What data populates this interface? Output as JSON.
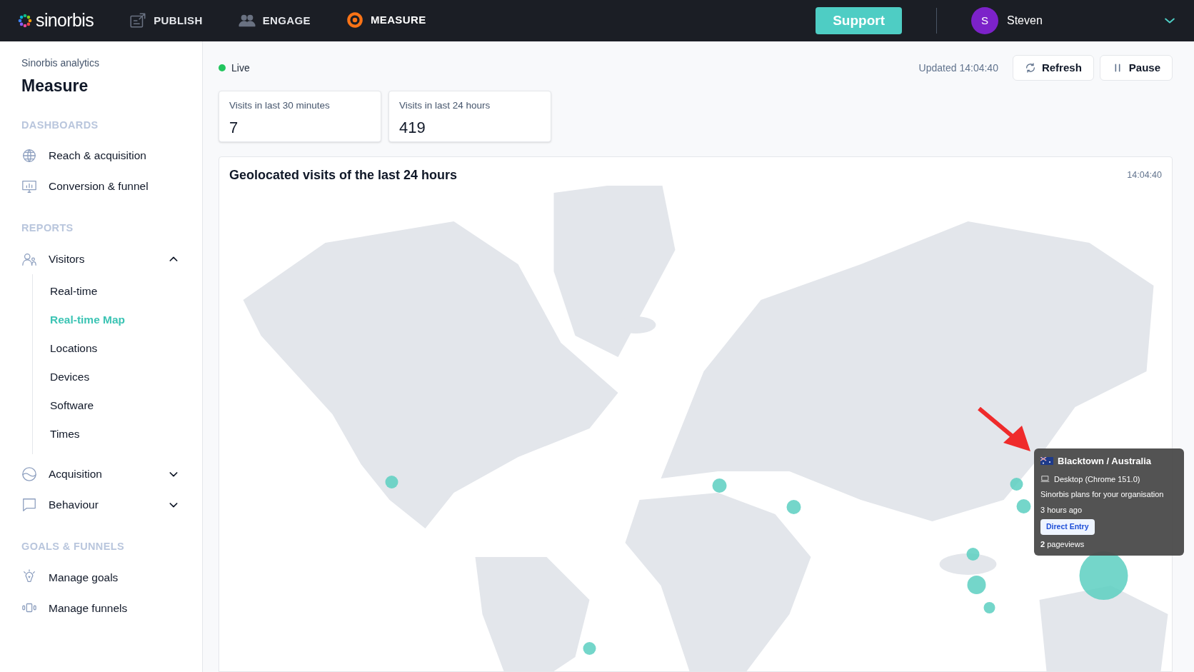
{
  "header": {
    "logo": "sinorbis",
    "nav": [
      {
        "label": "PUBLISH",
        "selected": false
      },
      {
        "label": "ENGAGE",
        "selected": false
      },
      {
        "label": "MEASURE",
        "selected": true
      }
    ],
    "support": "Support",
    "user": {
      "initial": "S",
      "name": "Steven"
    }
  },
  "sidebar": {
    "subtitle": "Sinorbis analytics",
    "title": "Measure",
    "sections": [
      {
        "heading": "DASHBOARDS",
        "items": [
          {
            "label": "Reach & acquisition"
          },
          {
            "label": "Conversion & funnel"
          }
        ]
      },
      {
        "heading": "REPORTS",
        "items": [
          {
            "label": "Visitors",
            "expanded": true,
            "children": [
              {
                "label": "Real-time",
                "selected": false
              },
              {
                "label": "Real-time Map",
                "selected": true
              },
              {
                "label": "Locations",
                "selected": false
              },
              {
                "label": "Devices",
                "selected": false
              },
              {
                "label": "Software",
                "selected": false
              },
              {
                "label": "Times",
                "selected": false
              }
            ]
          },
          {
            "label": "Acquisition",
            "expanded": false
          },
          {
            "label": "Behaviour",
            "expanded": false
          }
        ]
      },
      {
        "heading": "GOALS & FUNNELS",
        "items": [
          {
            "label": "Manage goals"
          },
          {
            "label": "Manage funnels"
          }
        ]
      }
    ]
  },
  "live": {
    "label": "Live",
    "on": true
  },
  "updated": "Updated 14:04:40",
  "buttons": [
    "Refresh",
    "Pause"
  ],
  "stats": [
    {
      "label": "Visits in last 30 minutes",
      "value": "7"
    },
    {
      "label": "Visits in last 24 hours",
      "value": "419"
    }
  ],
  "map": {
    "title": "Geolocated visits of the last 24 hours",
    "time": "14:04:40",
    "tooltip": {
      "title": "Blacktown / Australia",
      "device": "Desktop (Chrome 151.0)",
      "page": "Sinorbis plans for your organisation",
      "time": "3 hours ago",
      "source": "Direct Entry",
      "pageviews": "**2** pageviews"
    }
  }
}
